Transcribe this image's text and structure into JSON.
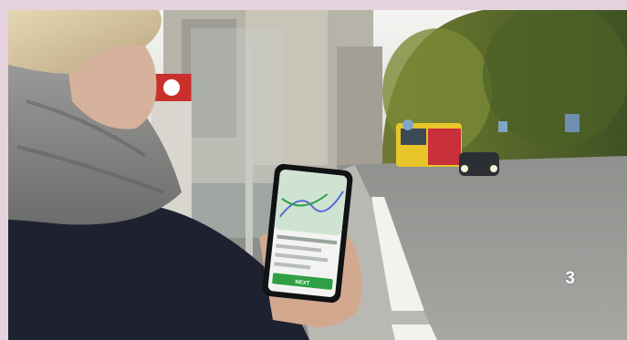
{
  "photo": {
    "subject": "person-holding-phone-at-bus-stop",
    "page_number": "3"
  },
  "phone_screen": {
    "button_label": "NEXT"
  },
  "colors": {
    "frame_background": "#e4d3dc",
    "app_green": "#2ea043",
    "bus_yellow": "#e8c62a",
    "bus_red": "#c8303a",
    "trees": "#5c6f2c",
    "jacket": "#1e2230"
  }
}
